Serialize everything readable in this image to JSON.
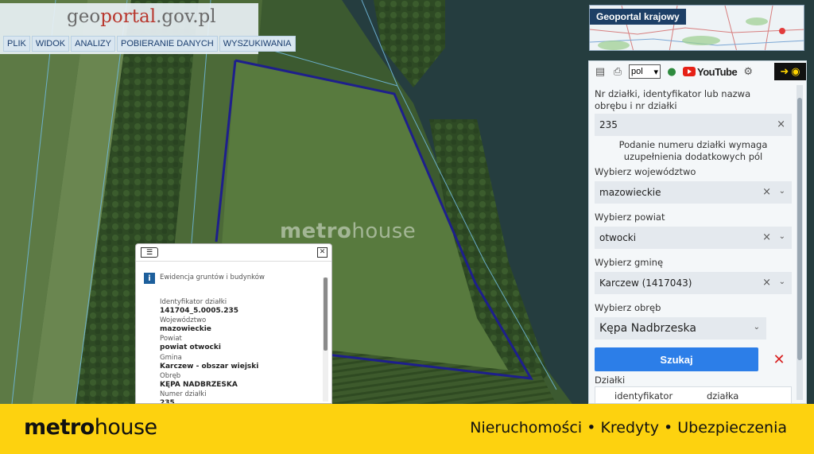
{
  "logo": {
    "geo": "geo",
    "portal": "portal",
    "suffix": ".gov.pl"
  },
  "menu": [
    "PLIK",
    "WIDOK",
    "ANALIZY",
    "POBIERANIE DANYCH",
    "WYSZUKIWANIA"
  ],
  "watermark": {
    "bold": "metro",
    "light": "house"
  },
  "minimap": {
    "title": "Geoportal krajowy"
  },
  "toolbar": {
    "lang": "pol",
    "youtube": "YouTube"
  },
  "search": {
    "prompt": "Nr działki, identyfikator lub nazwa obrębu i nr działki",
    "value": "235",
    "clear": "×",
    "note": "Podanie numeru działki wymaga uzupełnienia dodatkowych pól",
    "wojewodztwo_label": "Wybierz województwo",
    "wojewodztwo_value": "mazowieckie",
    "powiat_label": "Wybierz powiat",
    "powiat_value": "otwocki",
    "gmina_label": "Wybierz gminę",
    "gmina_value": "Karczew (1417043)",
    "obreb_label": "Wybierz obręb",
    "obreb_value": "Kępa Nadbrzeska",
    "search_button": "Szukaj",
    "reset_button": "✕",
    "results_label": "Działki",
    "col_identyfikator": "identyfikator",
    "col_dzialka": "działka"
  },
  "popup": {
    "title": "Ewidencja gruntów i budynków",
    "fields": [
      {
        "label": "Identyfikator działki",
        "value": "141704_5.0005.235"
      },
      {
        "label": "Województwo",
        "value": "mazowieckie"
      },
      {
        "label": "Powiat",
        "value": "powiat otwocki"
      },
      {
        "label": "Gmina",
        "value": "Karczew - obszar wiejski"
      },
      {
        "label": "Obręb",
        "value": "KĘPA NADBRZESKA"
      },
      {
        "label": "Numer działki",
        "value": "235"
      }
    ]
  },
  "bottom": {
    "brand_bold": "metr",
    "brand_o": "o",
    "brand_light": "house",
    "tagline": "Nieruchomości • Kredyty • Ubezpieczenia"
  },
  "colors": {
    "brand_yellow": "#fdd20f",
    "parcel_border": "#1e1f8c",
    "search_button": "#2c7ee8"
  }
}
